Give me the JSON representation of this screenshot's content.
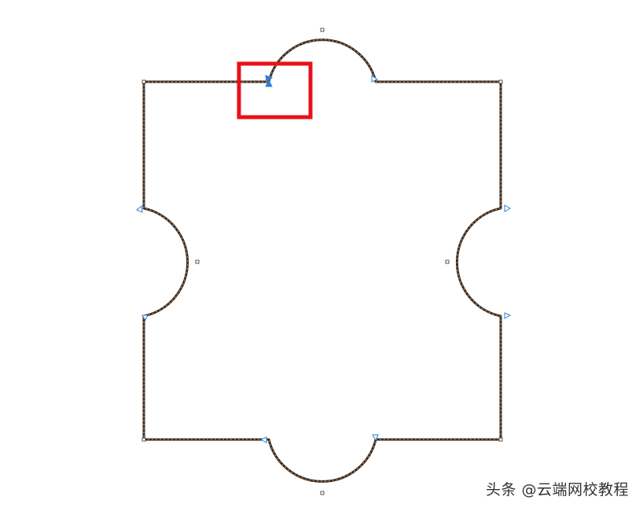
{
  "colors": {
    "outline": "#3b2a1f",
    "outline_dash": "#c7a27a",
    "node_marker": "#2f7fd6",
    "selection_highlight": "#e8111a",
    "background": "#ffffff"
  },
  "watermark": {
    "text": "头条 @云端网校教程"
  },
  "icons": {
    "node_marker": "triangle-node-icon"
  }
}
